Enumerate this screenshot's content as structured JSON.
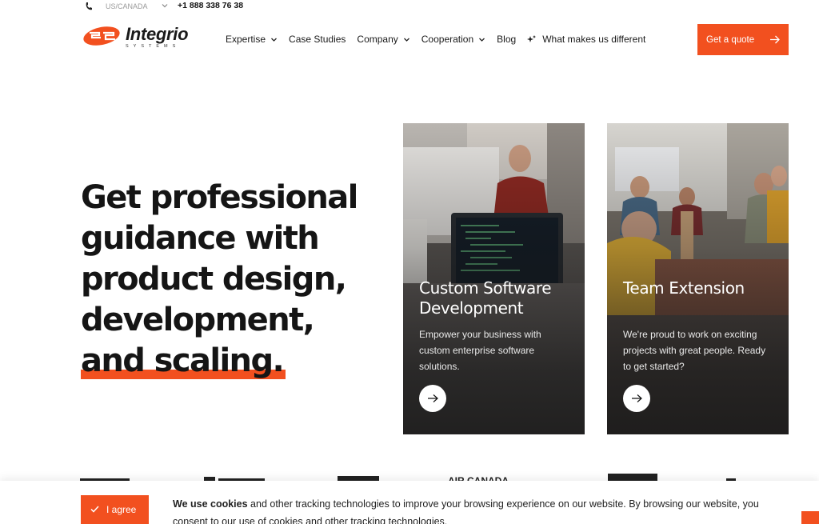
{
  "topbar": {
    "region": "US/CANADA",
    "phone": "+1 888 338 76 38",
    "phone_icon": "phone-icon"
  },
  "header": {
    "logo_word": "Integrio",
    "logo_sub": "SYSTEMS",
    "nav": [
      {
        "label": "Expertise",
        "has_dropdown": true
      },
      {
        "label": "Case Studies",
        "has_dropdown": false
      },
      {
        "label": "Company",
        "has_dropdown": true
      },
      {
        "label": "Cooperation",
        "has_dropdown": true
      },
      {
        "label": "Blog",
        "has_dropdown": false
      },
      {
        "label": "What makes us different",
        "has_dropdown": false,
        "icon": "sparkle-icon"
      }
    ],
    "cta_label": "Get a quote",
    "accent_color": "#f2501f"
  },
  "hero": {
    "lines": [
      "Get professional",
      "guidance with",
      "product design,",
      "development,"
    ],
    "highlight": "and scaling."
  },
  "cards": [
    {
      "title": "Custom Software Development",
      "text": "Empower your business with custom enterprise software solutions.",
      "button_icon": "arrow-right-icon"
    },
    {
      "title": "Team Extension",
      "text": "We're proud to work on exciting projects with great people. Ready to get started?",
      "button_icon": "arrow-right-icon"
    }
  ],
  "clients": [
    "AIR CANADA"
  ],
  "cookie": {
    "agree_label": "I agree",
    "bold": "We use cookies",
    "text": " and other tracking technologies to improve your browsing experience on our website. By browsing our website, you consent to our use of cookies and other tracking technologies."
  }
}
